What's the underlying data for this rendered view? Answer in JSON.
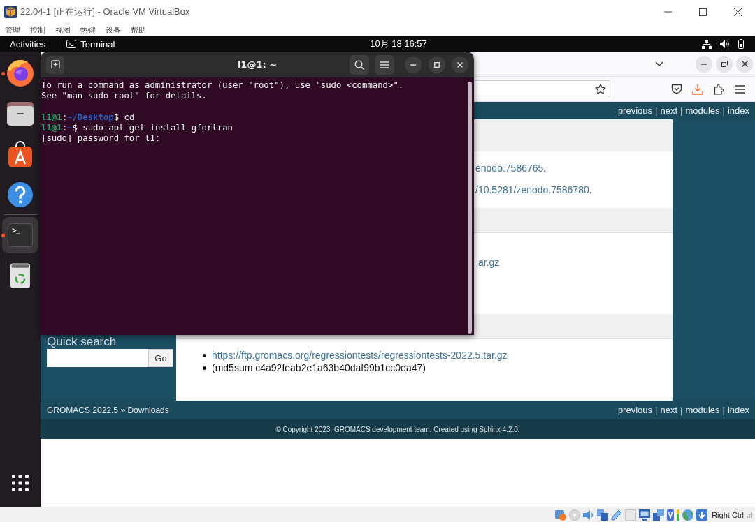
{
  "vbox": {
    "title": "22.04-1 [正在运行] - Oracle VM VirtualBox",
    "menu": [
      "管理",
      "控制",
      "视图",
      "热键",
      "设备",
      "帮助"
    ]
  },
  "top_bar": {
    "activities": "Activities",
    "app_name": "Terminal",
    "clock": "10月 18 16:57"
  },
  "dock": {
    "groups": [
      {
        "items": [
          {
            "kind": "firefox",
            "running": true,
            "selected": false
          },
          {
            "kind": "files",
            "running": false,
            "selected": false
          },
          {
            "kind": "software",
            "running": false,
            "selected": false
          },
          {
            "kind": "help",
            "running": false,
            "selected": false
          }
        ]
      },
      {
        "items": [
          {
            "kind": "terminal",
            "running": true,
            "selected": true
          },
          {
            "kind": "trash",
            "running": false,
            "selected": false
          }
        ]
      }
    ]
  },
  "terminal": {
    "title": "l1@1: ~",
    "blocks": [
      {
        "lines": [
          {
            "segments": [
              {
                "kind": "plain",
                "text": "To run a command as administrator (user \"root\"), use \"sudo <command>\"."
              }
            ]
          },
          {
            "segments": [
              {
                "kind": "plain",
                "text": "See \"man sudo_root\" for details."
              }
            ]
          }
        ]
      },
      {
        "lines": [
          {
            "segments": [
              {
                "kind": "user",
                "text": "l1@1"
              },
              {
                "kind": "plain",
                "text": ":"
              },
              {
                "kind": "path",
                "text": "~/Desktop"
              },
              {
                "kind": "plain",
                "text": "$ cd"
              }
            ]
          },
          {
            "segments": [
              {
                "kind": "user",
                "text": "l1@1"
              },
              {
                "kind": "plain",
                "text": ":"
              },
              {
                "kind": "path",
                "text": "~"
              },
              {
                "kind": "plain",
                "text": "$ sudo apt-get install gfortran"
              }
            ]
          },
          {
            "segments": [
              {
                "kind": "plain",
                "text": "[sudo] password for l1:"
              }
            ]
          }
        ]
      }
    ]
  },
  "browser": {
    "related_top": [
      {
        "kind": "link",
        "text": "previous"
      },
      {
        "kind": "separator",
        "text": "|"
      },
      {
        "kind": "link",
        "text": "next"
      },
      {
        "kind": "separator",
        "text": "|"
      },
      {
        "kind": "link",
        "text": "modules"
      },
      {
        "kind": "separator",
        "text": "|"
      },
      {
        "kind": "link",
        "text": "index"
      }
    ],
    "sidebar": {
      "heading": "Quick search",
      "button": "Go"
    },
    "sections": [
      {
        "lines": [
          {
            "link": "enodo.7586765",
            "after": "."
          },
          {
            "link": "/10.5281/zenodo.7586780",
            "after": "."
          }
        ]
      },
      {
        "lines": [
          {
            "link": "ar.gz"
          }
        ]
      },
      {
        "bullets": [
          {
            "kind": "link",
            "text": "https://ftp.gromacs.org/regressiontests/regressiontests-2022.5.tar.gz"
          },
          {
            "kind": "text",
            "text": "(md5sum c4a92feab2e1a63b40daf99b1cc0ea47)"
          }
        ]
      }
    ],
    "related_bottom": {
      "breadcrumb": "GROMACS 2022.5 » Downloads",
      "nav": [
        {
          "kind": "link",
          "text": "previous"
        },
        {
          "kind": "separator",
          "text": "|"
        },
        {
          "kind": "link",
          "text": "next"
        },
        {
          "kind": "separator",
          "text": "|"
        },
        {
          "kind": "link",
          "text": "modules"
        },
        {
          "kind": "separator",
          "text": "|"
        },
        {
          "kind": "link",
          "text": "index"
        }
      ]
    },
    "footer": {
      "before": "© Copyright 2023, GROMACS development team. Created using",
      "link": "Sphinx",
      "after": "4.2.0."
    }
  },
  "status_bar": {
    "host_key": "Right Ctrl"
  }
}
